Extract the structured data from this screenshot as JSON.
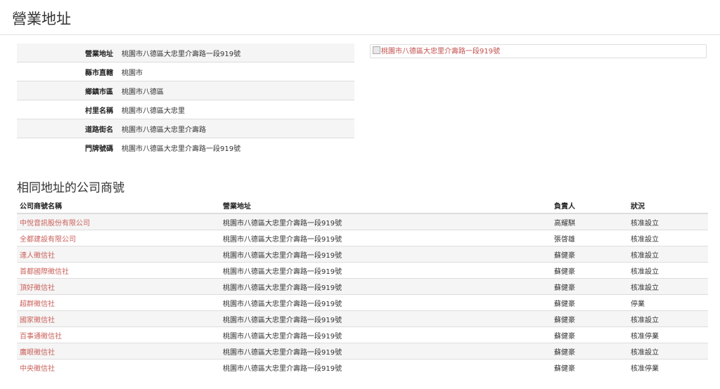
{
  "page": {
    "title": "營業地址"
  },
  "address_info": [
    {
      "label": "營業地址",
      "value": "桃園市八德區大忠里介壽路一段919號"
    },
    {
      "label": "縣市直轄",
      "value": "桃園市"
    },
    {
      "label": "鄉鎮市區",
      "value": "桃園市八德區"
    },
    {
      "label": "村里名稱",
      "value": "桃園市八德區大忠里"
    },
    {
      "label": "道路街名",
      "value": "桃園市八德區大忠里介壽路"
    },
    {
      "label": "門牌號碼",
      "value": "桃園市八德區大忠里介壽路一段919號"
    }
  ],
  "map": {
    "alt_text": "桃園市八德區大忠里介壽路一段919號"
  },
  "same_address": {
    "title": "相同地址的公司商號",
    "headers": [
      "公司商號名稱",
      "營業地址",
      "負責人",
      "狀況"
    ],
    "rows": [
      {
        "name": "中悅音訊股份有限公司",
        "address": "桃園市八德區大忠里介壽路一段919號",
        "owner": "高耀騏",
        "status": "核准設立"
      },
      {
        "name": "全都建設有限公司",
        "address": "桃園市八德區大忠里介壽路一段919號",
        "owner": "張啓雄",
        "status": "核准設立"
      },
      {
        "name": "達人徵信社",
        "address": "桃園市八德區大忠里介壽路一段919號",
        "owner": "蘇健豪",
        "status": "核准設立"
      },
      {
        "name": "首都國際徵信社",
        "address": "桃園市八德區大忠里介壽路一段919號",
        "owner": "蘇健豪",
        "status": "核准設立"
      },
      {
        "name": "頂好徵信社",
        "address": "桃園市八德區大忠里介壽路一段919號",
        "owner": "蘇健豪",
        "status": "核准設立"
      },
      {
        "name": "超群徵信社",
        "address": "桃園市八德區大忠里介壽路一段919號",
        "owner": "蘇健豪",
        "status": "停業"
      },
      {
        "name": "國家徵信社",
        "address": "桃園市八德區大忠里介壽路一段919號",
        "owner": "蘇健豪",
        "status": "核准設立"
      },
      {
        "name": "百事通徵信社",
        "address": "桃園市八德區大忠里介壽路一段919號",
        "owner": "蘇健豪",
        "status": "核准停業"
      },
      {
        "name": "鷹眼徵信社",
        "address": "桃園市八德區大忠里介壽路一段919號",
        "owner": "蘇健豪",
        "status": "核准設立"
      },
      {
        "name": "中央徵信社",
        "address": "桃園市八德區大忠里介壽路一段919號",
        "owner": "蘇健豪",
        "status": "核准停業"
      }
    ]
  },
  "colors": {
    "link": "#c9605a",
    "stripe": "#f5f5f5",
    "border": "#dddddd"
  }
}
